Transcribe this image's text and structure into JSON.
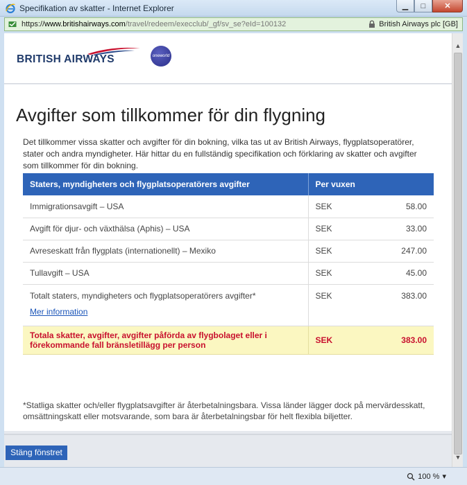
{
  "window": {
    "title": "Specifikation av skatter - Internet Explorer",
    "url_protocol": "https://",
    "url_host": "www.britishairways.com",
    "url_path": "/travel/redeem/execclub/_gf/sv_se?eId=100132",
    "cert_label": "British Airways plc [GB]",
    "zoom": "100 %"
  },
  "header": {
    "logo_text": "BRITISH AIRWAYS",
    "alliance_text": "oneworld"
  },
  "page": {
    "heading": "Avgifter som tillkommer för din flygning",
    "intro": "Det tillkommer vissa skatter och avgifter för din bokning, vilka tas ut av British Airways, flygplatsoperatörer, stater och andra myndigheter. Här hittar du en fullständig specifikation och förklaring av skatter och avgifter som tillkommer för din bokning."
  },
  "table": {
    "col1_header": "Staters, myndigheters och flygplatsoperatörers avgifter",
    "col2_header": "Per vuxen",
    "rows": [
      {
        "label": "Immigrationsavgift – USA",
        "currency": "SEK",
        "amount": "58.00"
      },
      {
        "label": "Avgift för djur- och växthälsa (Aphis) – USA",
        "currency": "SEK",
        "amount": "33.00"
      },
      {
        "label": "Avreseskatt från flygplats (internationellt) – Mexiko",
        "currency": "SEK",
        "amount": "247.00"
      },
      {
        "label": "Tullavgift – USA",
        "currency": "SEK",
        "amount": "45.00"
      }
    ],
    "subtotal": {
      "label": "Totalt staters, myndigheters och flygplatsoperatörers avgifter*",
      "currency": "SEK",
      "amount": "383.00"
    },
    "more_link": "Mer information",
    "grand_total": {
      "label": "Totala skatter, avgifter, avgifter påförda av flygbolaget eller i förekommande fall bränsletillägg per person",
      "currency": "SEK",
      "amount": "383.00"
    }
  },
  "footnote": "*Statliga skatter och/eller flygplatsavgifter är återbetalningsbara. Vissa länder lägger dock på mervärdesskatt, omsättningskatt eller motsvarande, som bara är återbetalningsbar för helt flexibla biljetter.",
  "buttons": {
    "close_window": "Stäng fönstret"
  },
  "colors": {
    "brand_blue": "#2e64b8",
    "total_red": "#c8102e",
    "total_bg": "#fbf7c1"
  }
}
